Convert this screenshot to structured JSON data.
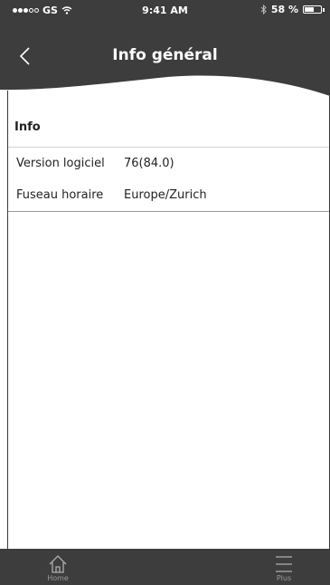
{
  "status_bar": {
    "carrier": "GS",
    "time": "9:41 AM",
    "battery": "58 %",
    "battery_level": 0.58
  },
  "header": {
    "title": "Info général",
    "back_icon": "chevron-left-icon"
  },
  "section": {
    "title": "Info"
  },
  "info_rows": [
    {
      "label": "Version logiciel",
      "value": "76(84.0)"
    },
    {
      "label": "Fuseau horaire",
      "value": "Europe/Zurich"
    }
  ],
  "tab_bar": {
    "home_label": "Home",
    "home_icon": "home-icon",
    "plus_label": "Plus",
    "plus_icon": "hamburger-menu-icon"
  },
  "colors": {
    "header_bg": "#3d3d3d",
    "tab_bar_bg": "#3d3d3d",
    "tab_label": "#9a9a9a",
    "text": "#222222"
  }
}
